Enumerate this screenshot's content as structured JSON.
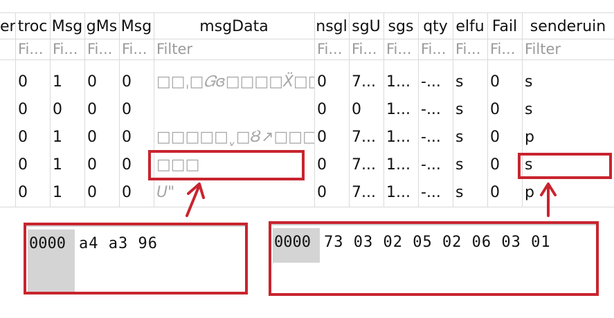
{
  "columns": [
    {
      "header": "en",
      "filter": ""
    },
    {
      "header": "troc",
      "filter": "Fi..."
    },
    {
      "header": "Msg",
      "filter": "Fi..."
    },
    {
      "header": "gMs",
      "filter": "Fi..."
    },
    {
      "header": "Msg",
      "filter": "Fi..."
    },
    {
      "header": "msgData",
      "filter": "Filter"
    },
    {
      "header": "nsgl",
      "filter": "Fi..."
    },
    {
      "header": "sgU",
      "filter": "Fi..."
    },
    {
      "header": "sgs",
      "filter": "Fi..."
    },
    {
      "header": "qty",
      "filter": "Fi..."
    },
    {
      "header": "elfu",
      "filter": "Fi..."
    },
    {
      "header": "Fail",
      "filter": "Fi..."
    },
    {
      "header": "senderuin",
      "filter": "Filter"
    }
  ],
  "rows": [
    [
      "",
      "0",
      "1",
      "0",
      "0",
      "□□ˌ□𝐺ɞ□□□□Ẍ□□...",
      "0",
      "7...",
      "1...",
      "-...",
      "s",
      "0",
      "s"
    ],
    [
      "",
      "0",
      "0",
      "0",
      "0",
      "",
      "0",
      "0",
      "1...",
      "-...",
      "s",
      "0",
      "s"
    ],
    [
      "",
      "0",
      "1",
      "0",
      "0",
      "□□□□□ˬ□Ȣ↗□□□□□...",
      "0",
      "7...",
      "1...",
      "-...",
      "s",
      "0",
      "p"
    ],
    [
      "",
      "0",
      "1",
      "0",
      "0",
      "□□□",
      "0",
      "7...",
      "1...",
      "-...",
      "s",
      "0",
      "s"
    ],
    [
      "",
      "0",
      "1",
      "0",
      "0",
      "U\"",
      "0",
      "7...",
      "1...",
      "-...",
      "s",
      "0",
      "p"
    ]
  ],
  "hex_left": {
    "address": "0000",
    "bytes": "a4 a3 96"
  },
  "hex_right": {
    "address": "0000",
    "bytes": "73 03 02 05 02 06 03 01"
  },
  "annotation_color": "#c8242f"
}
